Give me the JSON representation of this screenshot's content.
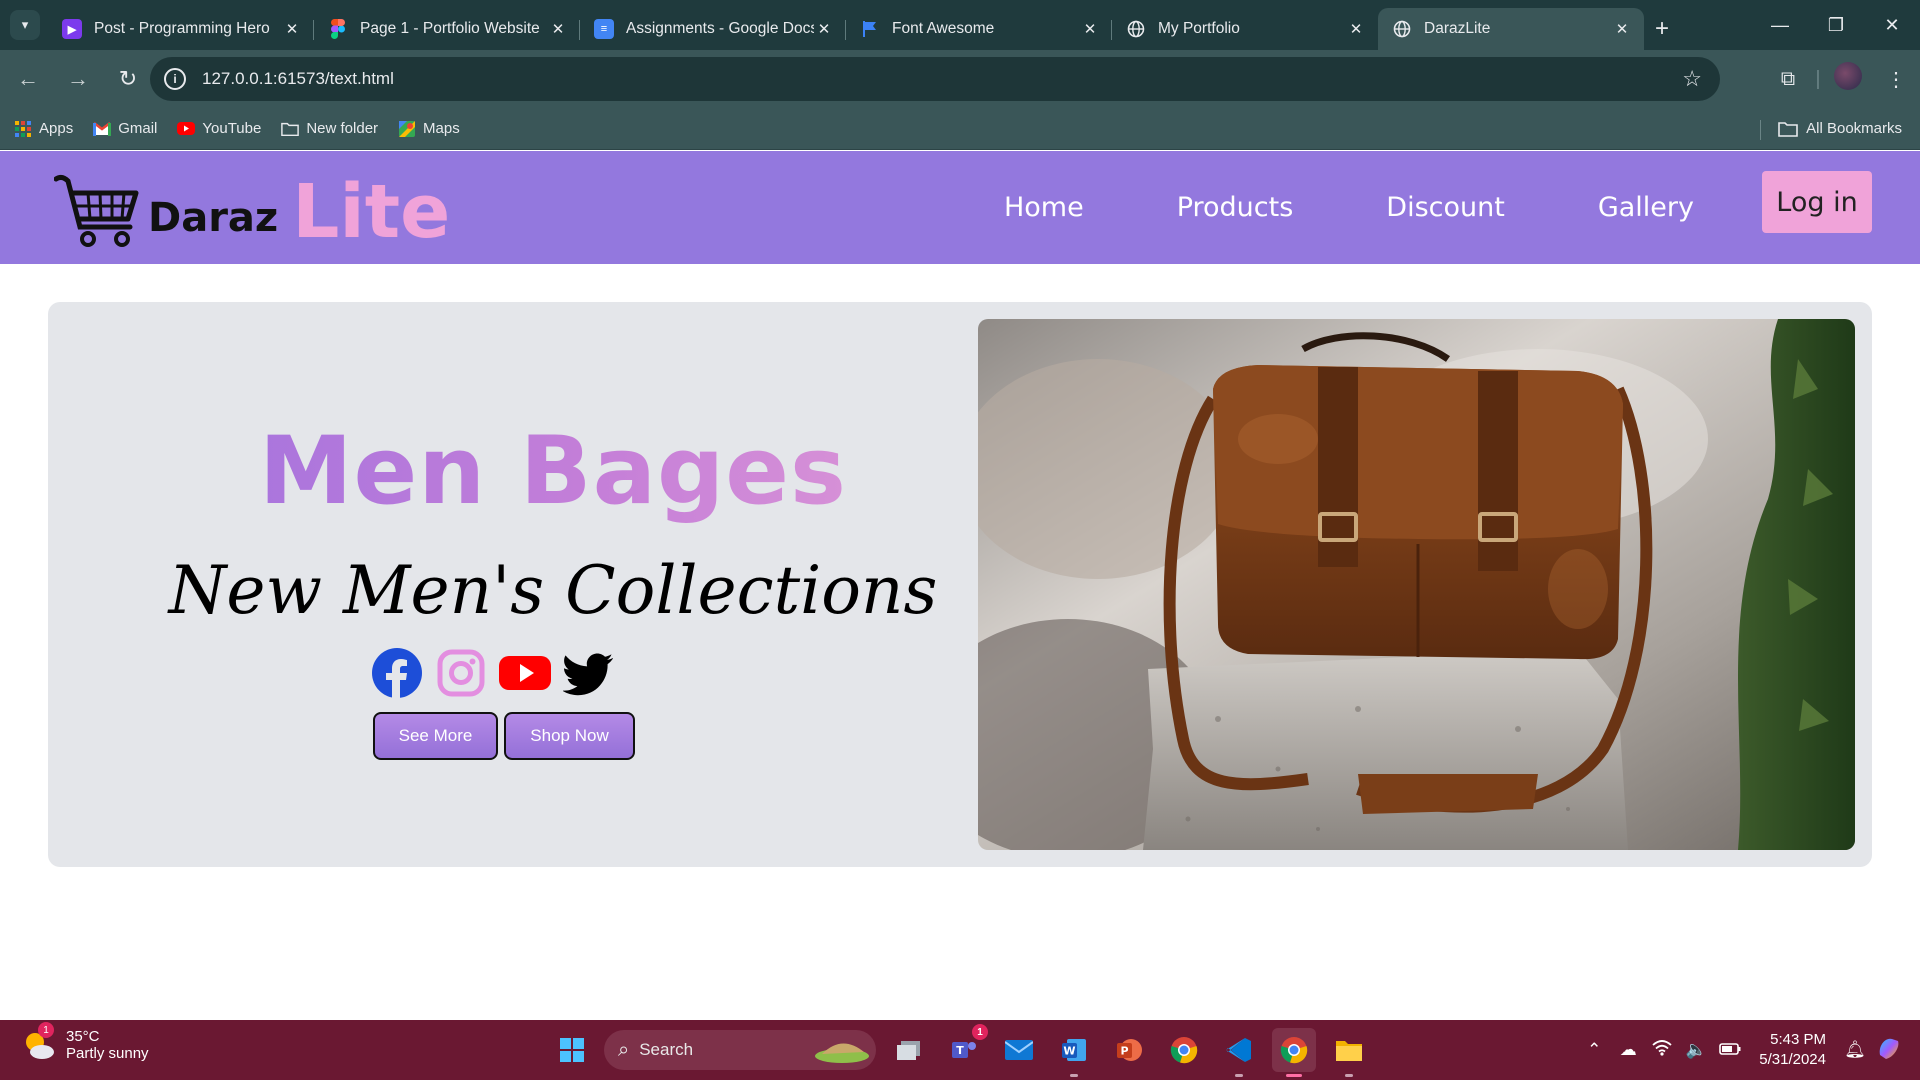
{
  "browser": {
    "tabs": [
      {
        "title": "Post - Programming Hero",
        "active": false
      },
      {
        "title": "Page 1 - Portfolio Website",
        "active": false
      },
      {
        "title": "Assignments - Google Docs",
        "active": false
      },
      {
        "title": "Font Awesome",
        "active": false
      },
      {
        "title": "My Portfolio",
        "active": false
      },
      {
        "title": "DarazLite",
        "active": true
      }
    ],
    "url": "127.0.0.1:61573/text.html",
    "bookmarks": [
      {
        "label": "Apps"
      },
      {
        "label": "Gmail"
      },
      {
        "label": "YouTube"
      },
      {
        "label": "New folder"
      },
      {
        "label": "Maps"
      }
    ],
    "all_bookmarks": "All Bookmarks"
  },
  "site": {
    "logo_word": "Daraz",
    "logo_accent": "Lite",
    "nav": [
      "Home",
      "Products",
      "Discount",
      "Gallery"
    ],
    "login": "Log in",
    "hero": {
      "title": "Men Bages",
      "subtitle": "New Men's Collections",
      "buttons": [
        "See More",
        "Shop Now"
      ],
      "socials": [
        "facebook-icon",
        "instagram-icon",
        "youtube-icon",
        "twitter-icon"
      ]
    },
    "colors": {
      "nav_bg": "#9378de",
      "accent_pink": "#f0a3d9",
      "hero_bg": "#e4e6ea"
    }
  },
  "taskbar": {
    "weather_temp": "35°C",
    "weather_desc": "Partly sunny",
    "weather_badge": "1",
    "search": "Search",
    "teams_badge": "1",
    "time": "5:43 PM",
    "date": "5/31/2024"
  }
}
